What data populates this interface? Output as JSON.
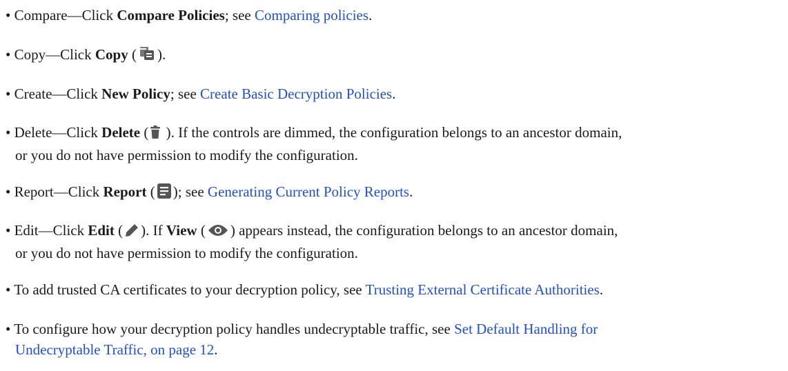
{
  "items": [
    {
      "lead": "• Compare—Click ",
      "bold": "Compare Policies",
      "mid": "; see ",
      "link": "Comparing policies",
      "tail": "."
    },
    {
      "lead": "• Copy—Click ",
      "bold": "Copy",
      "pre_icon": " (",
      "icon": "copy-icon",
      "post_icon": ")."
    },
    {
      "lead": "• Create—Click ",
      "bold": "New Policy",
      "mid": "; see ",
      "link": "Create Basic Decryption Policies",
      "tail": "."
    },
    {
      "lead": "• Delete—Click ",
      "bold": "Delete",
      "pre_icon": " (",
      "icon": "trash-icon",
      "post_icon": " ). If the controls are dimmed, the configuration belongs to an ancestor domain,",
      "line2": "or you do not have permission to modify the configuration."
    },
    {
      "lead": "• Report—Click ",
      "bold": "Report",
      "pre_icon": " (",
      "icon": "report-icon",
      "post_icon": "); see ",
      "link": "Generating Current Policy Reports",
      "tail": "."
    },
    {
      "lead": "• Edit—Click ",
      "bold": "Edit",
      "pre_icon": " (",
      "icon": "pencil-icon",
      "post_icon": "). If ",
      "bold2": "View",
      "pre_icon2": " (",
      "icon2": "eye-icon",
      "post_icon2": ") appears instead, the configuration belongs to an ancestor domain,",
      "line2": "or you do not have permission to modify the configuration."
    },
    {
      "lead": "• To add trusted CA certificates to your decryption policy, see ",
      "link": "Trusting External Certificate Authorities",
      "tail": "."
    },
    {
      "lead": "• To configure how your decryption policy handles undecryptable traffic, see ",
      "link": "Set Default Handling for",
      "line2_link": "Undecryptable Traffic, on page 12",
      "line2_tail": "."
    }
  ],
  "colors": {
    "link": "#1f4fd6",
    "text": "#1a1a1a",
    "icon": "#555555"
  }
}
